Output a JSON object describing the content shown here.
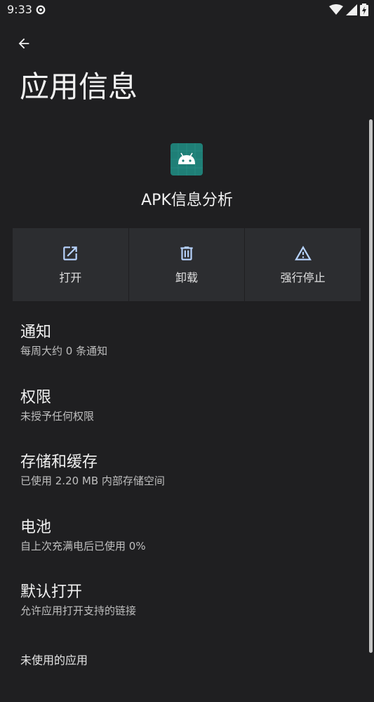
{
  "status_bar": {
    "time": "9:33"
  },
  "header": {
    "title": "应用信息"
  },
  "app": {
    "name": "APK信息分析"
  },
  "actions": [
    {
      "label": "打开",
      "icon": "open-external-icon"
    },
    {
      "label": "卸载",
      "icon": "trash-icon"
    },
    {
      "label": "强行停止",
      "icon": "warning-icon"
    }
  ],
  "settings": [
    {
      "title": "通知",
      "subtitle": "每周大约 0 条通知"
    },
    {
      "title": "权限",
      "subtitle": "未授予任何权限"
    },
    {
      "title": "存储和缓存",
      "subtitle": "已使用 2.20 MB 内部存储空间"
    },
    {
      "title": "电池",
      "subtitle": "自上次充满电后已使用 0%"
    },
    {
      "title": "默认打开",
      "subtitle": "允许应用打开支持的链接"
    },
    {
      "title": "未使用的应用",
      "subtitle": ""
    }
  ],
  "colors": {
    "background": "#1f1f21",
    "button_bg": "#2c2d30",
    "icon_accent": "#b8d4ff",
    "app_icon_bg": "#1f7f77"
  }
}
